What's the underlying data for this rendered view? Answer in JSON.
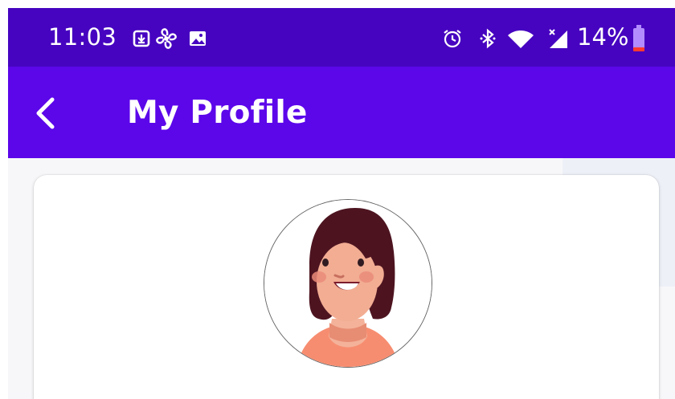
{
  "status_bar": {
    "time": "11:03",
    "battery": "14%",
    "left_icons": [
      "download-notification-icon",
      "fan-icon",
      "image-icon"
    ],
    "right_icons": [
      "alarm-icon",
      "bluetooth-icon",
      "wifi-icon",
      "cellular-icon",
      "battery-icon"
    ],
    "color": "#4604c0"
  },
  "app_bar": {
    "title": "My Profile",
    "back_icon": "chevron-left-icon",
    "color": "#5c06ea"
  },
  "profile": {
    "avatar": "avatar"
  }
}
